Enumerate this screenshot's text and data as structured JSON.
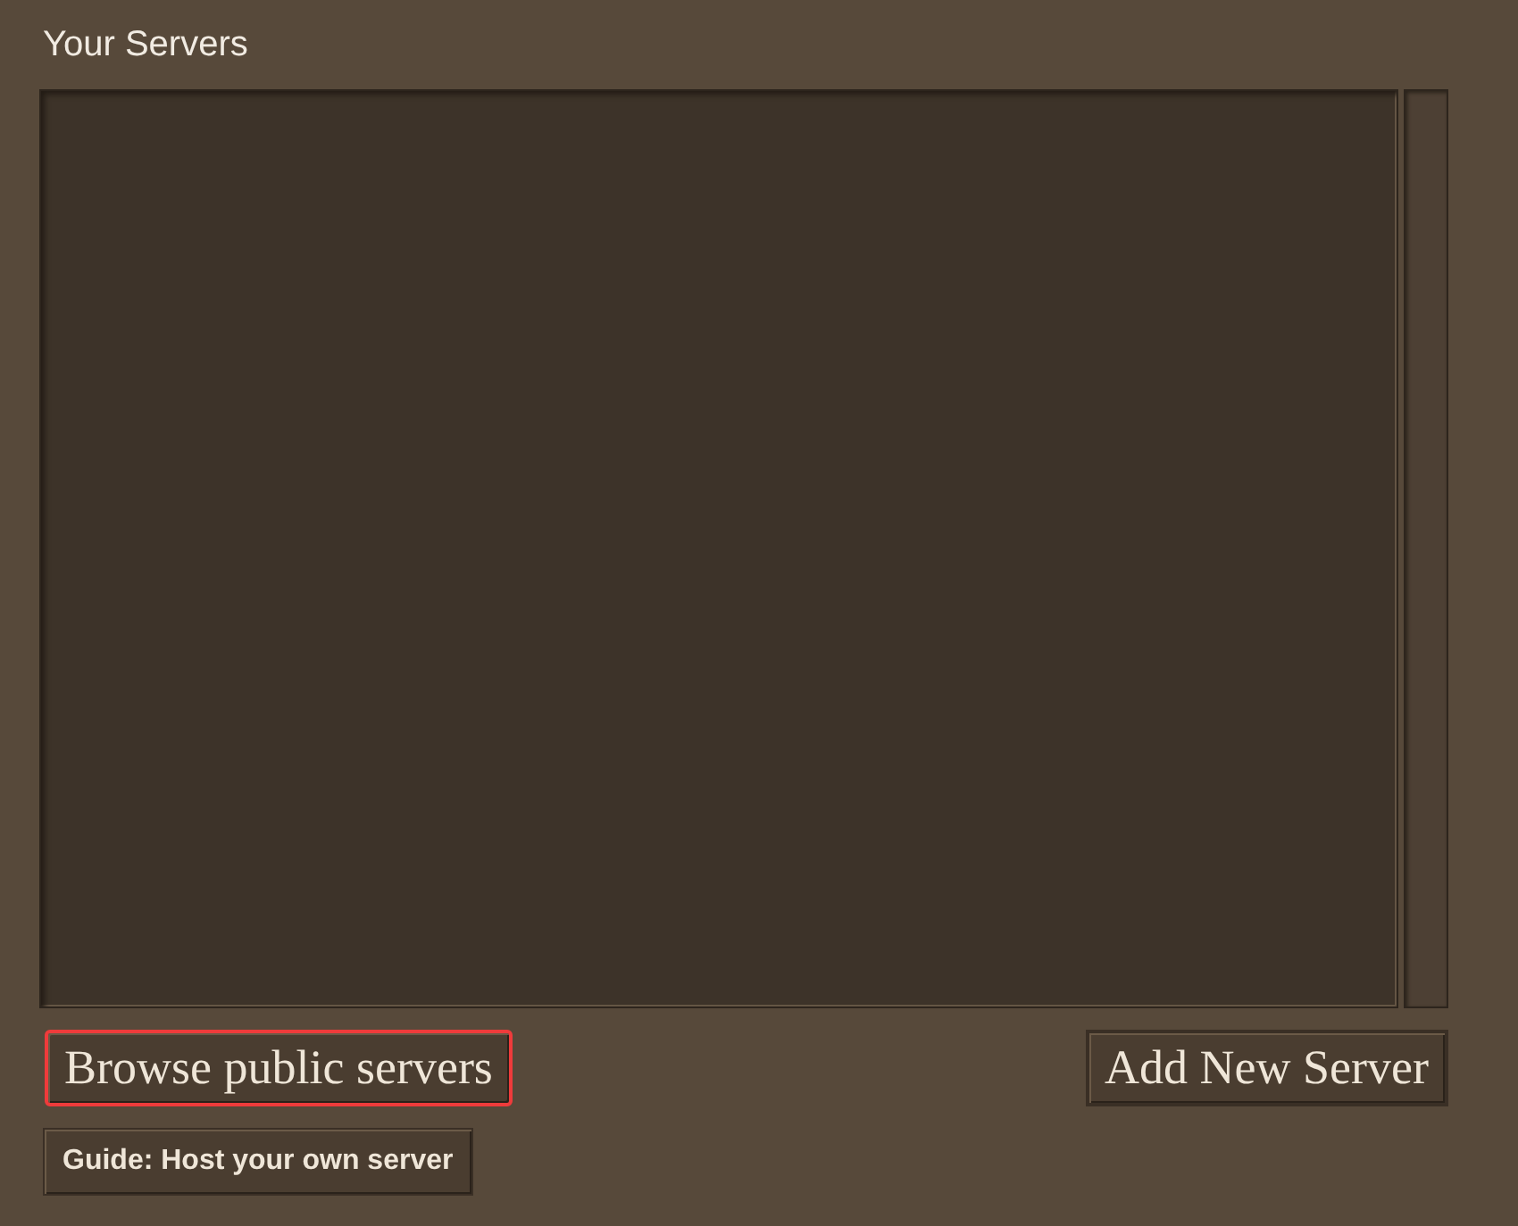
{
  "title": "Your Servers",
  "buttons": [
    {
      "label": "Browse public servers",
      "highlighted": true
    },
    {
      "label": "Add New Server",
      "highlighted": false
    }
  ],
  "guide_button": {
    "label": "Guide: Host your own server"
  }
}
